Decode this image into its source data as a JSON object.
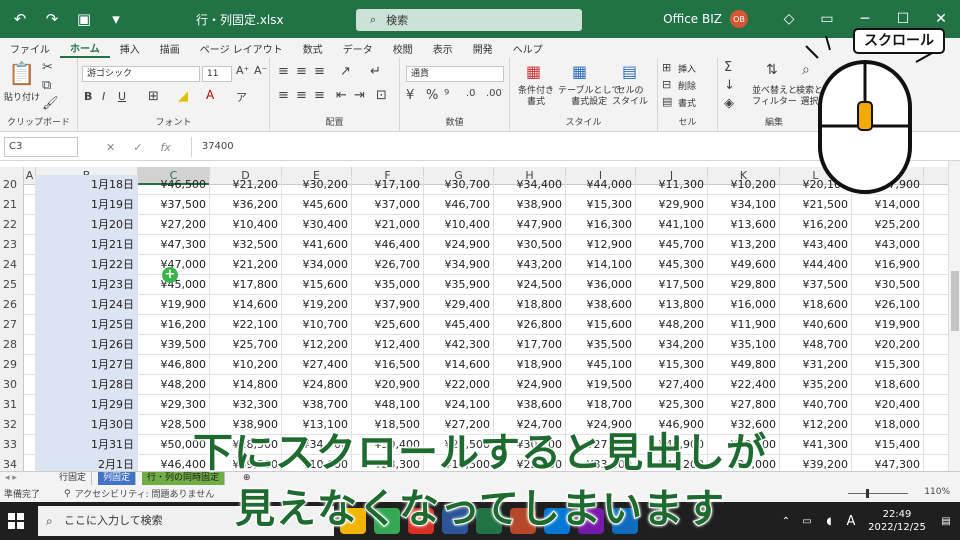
{
  "titlebar": {
    "title": "行・列固定.xlsx",
    "search_placeholder": "検索",
    "user": "Office BIZ",
    "avatar": "OB"
  },
  "tabs": [
    "ファイル",
    "ホーム",
    "挿入",
    "描画",
    "ページ レイアウト",
    "数式",
    "データ",
    "校閲",
    "表示",
    "開発",
    "ヘルプ"
  ],
  "active_tab": "ホーム",
  "ribbon": {
    "paste": "貼り付け",
    "clipboard": "クリップボード",
    "font_name": "游ゴシック",
    "font_size": "11",
    "font": "フォント",
    "alignment": "配置",
    "number_format": "通貨",
    "number": "数値",
    "cond_format": "条件付き\n書式",
    "table_format": "テーブルとして\n書式設定",
    "cell_style": "セルの\nスタイル",
    "style": "スタイル",
    "insert": "挿入",
    "delete": "削除",
    "format": "書式",
    "cells": "セル",
    "sort_filter": "並べ替えと\nフィルター",
    "find_select": "検索と\n選択",
    "editing": "編集"
  },
  "formula_bar": {
    "name_box": "C3",
    "value": "37400"
  },
  "columns": [
    "A",
    "B",
    "C",
    "D",
    "E",
    "F",
    "G",
    "H",
    "I",
    "J",
    "K",
    "L",
    "M"
  ],
  "selected_column": "C",
  "rows": [
    {
      "num": "20",
      "date": "1月18日",
      "values": [
        "¥46,500",
        "¥21,200",
        "¥30,200",
        "¥17,100",
        "¥30,700",
        "¥34,400",
        "¥44,000",
        "¥11,300",
        "¥10,200",
        "¥20,100",
        "¥47,900"
      ]
    },
    {
      "num": "21",
      "date": "1月19日",
      "values": [
        "¥37,500",
        "¥36,200",
        "¥45,600",
        "¥37,000",
        "¥46,700",
        "¥38,900",
        "¥15,300",
        "¥29,900",
        "¥34,100",
        "¥21,500",
        "¥14,000"
      ]
    },
    {
      "num": "22",
      "date": "1月20日",
      "values": [
        "¥27,200",
        "¥10,400",
        "¥30,400",
        "¥21,000",
        "¥10,400",
        "¥47,900",
        "¥16,300",
        "¥41,100",
        "¥13,600",
        "¥16,200",
        "¥25,200"
      ]
    },
    {
      "num": "23",
      "date": "1月21日",
      "values": [
        "¥47,300",
        "¥32,500",
        "¥41,600",
        "¥46,400",
        "¥24,900",
        "¥30,500",
        "¥12,900",
        "¥45,700",
        "¥13,200",
        "¥43,400",
        "¥43,000"
      ]
    },
    {
      "num": "24",
      "date": "1月22日",
      "values": [
        "¥47,000",
        "¥21,200",
        "¥34,000",
        "¥26,700",
        "¥34,900",
        "¥43,200",
        "¥14,100",
        "¥45,300",
        "¥49,600",
        "¥44,400",
        "¥16,900"
      ]
    },
    {
      "num": "25",
      "date": "1月23日",
      "values": [
        "¥45,000",
        "¥17,800",
        "¥15,600",
        "¥35,000",
        "¥35,900",
        "¥24,500",
        "¥36,000",
        "¥17,500",
        "¥29,800",
        "¥37,500",
        "¥30,500"
      ]
    },
    {
      "num": "26",
      "date": "1月24日",
      "values": [
        "¥19,900",
        "¥14,600",
        "¥19,200",
        "¥37,900",
        "¥29,400",
        "¥18,800",
        "¥38,600",
        "¥13,800",
        "¥16,000",
        "¥18,600",
        "¥26,100"
      ]
    },
    {
      "num": "27",
      "date": "1月25日",
      "values": [
        "¥16,200",
        "¥22,100",
        "¥10,700",
        "¥25,600",
        "¥45,400",
        "¥26,800",
        "¥15,600",
        "¥48,200",
        "¥11,900",
        "¥40,600",
        "¥19,900"
      ]
    },
    {
      "num": "28",
      "date": "1月26日",
      "values": [
        "¥39,500",
        "¥25,700",
        "¥12,200",
        "¥12,400",
        "¥42,300",
        "¥17,700",
        "¥35,500",
        "¥34,200",
        "¥35,100",
        "¥48,700",
        "¥20,200"
      ]
    },
    {
      "num": "29",
      "date": "1月27日",
      "values": [
        "¥46,800",
        "¥10,200",
        "¥27,400",
        "¥16,500",
        "¥14,600",
        "¥18,900",
        "¥45,100",
        "¥15,300",
        "¥49,800",
        "¥31,200",
        "¥15,300"
      ]
    },
    {
      "num": "30",
      "date": "1月28日",
      "values": [
        "¥48,200",
        "¥14,800",
        "¥24,800",
        "¥20,900",
        "¥22,000",
        "¥24,900",
        "¥19,500",
        "¥27,400",
        "¥22,400",
        "¥35,200",
        "¥18,600"
      ]
    },
    {
      "num": "31",
      "date": "1月29日",
      "values": [
        "¥29,300",
        "¥32,300",
        "¥38,700",
        "¥48,100",
        "¥24,100",
        "¥38,600",
        "¥18,700",
        "¥25,300",
        "¥27,800",
        "¥40,700",
        "¥20,400"
      ]
    },
    {
      "num": "32",
      "date": "1月30日",
      "values": [
        "¥28,500",
        "¥38,900",
        "¥13,100",
        "¥18,500",
        "¥27,200",
        "¥24,700",
        "¥24,900",
        "¥46,900",
        "¥32,600",
        "¥12,200",
        "¥18,000"
      ]
    },
    {
      "num": "33",
      "date": "1月31日",
      "values": [
        "¥50,000",
        "¥28,500",
        "¥34,900",
        "¥39,400",
        "¥24,500",
        "¥30,700",
        "¥27,800",
        "¥46,900",
        "¥10,500",
        "¥41,300",
        "¥15,400"
      ]
    },
    {
      "num": "34",
      "date": "2月1日",
      "values": [
        "¥46,400",
        "¥49,500",
        "¥10,600",
        "¥23,300",
        "¥16,500",
        "¥22,000",
        "¥33,400",
        "¥41,200",
        "¥26,000",
        "¥39,200",
        "¥47,300"
      ]
    }
  ],
  "sheets": [
    "行固定",
    "列固定",
    "行・列の同時固定"
  ],
  "active_sheet": "列固定",
  "status": {
    "ready": "準備完了",
    "accessibility": "アクセシビリティ: 問題ありません",
    "zoom": "110%"
  },
  "taskbar": {
    "search_placeholder": "ここに入力して検索",
    "time": "22:49",
    "date": "2022/12/25",
    "ime": "A"
  },
  "overlay": {
    "callout": "スクロール",
    "subtitle_line1": "下にスクロールすると見出しが",
    "subtitle_line2": "見えなくなってしまいます"
  },
  "colors": {
    "excel_green": "#217346",
    "subtitle_green": "#1e6b30",
    "selection_blue": "#dbe4f3",
    "mouse_wheel": "#f2a900"
  }
}
